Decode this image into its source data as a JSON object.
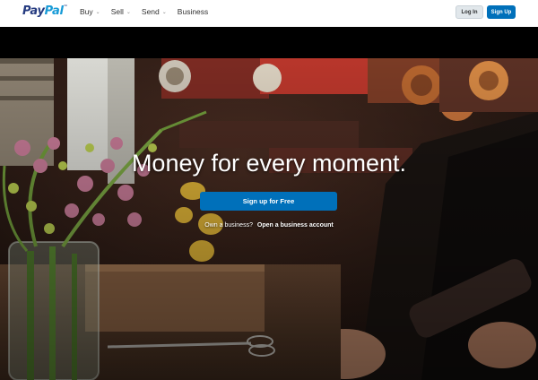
{
  "brand": {
    "logo_pay": "Pay",
    "logo_pal": "Pal",
    "logo_tm": "™"
  },
  "nav": {
    "items": [
      {
        "label": "Buy",
        "has_dropdown": true
      },
      {
        "label": "Sell",
        "has_dropdown": true
      },
      {
        "label": "Send",
        "has_dropdown": true
      },
      {
        "label": "Business",
        "has_dropdown": false
      }
    ],
    "chevron": "⌄"
  },
  "header": {
    "login_label": "Log In",
    "signup_label": "Sign Up"
  },
  "hero": {
    "headline": "Money for every moment.",
    "cta_label": "Sign up for Free",
    "business_question": "Own a business?",
    "business_link": "Open a business account"
  },
  "colors": {
    "brand_dark": "#253b80",
    "brand_light": "#179bd7",
    "cta_blue": "#0070ba"
  }
}
